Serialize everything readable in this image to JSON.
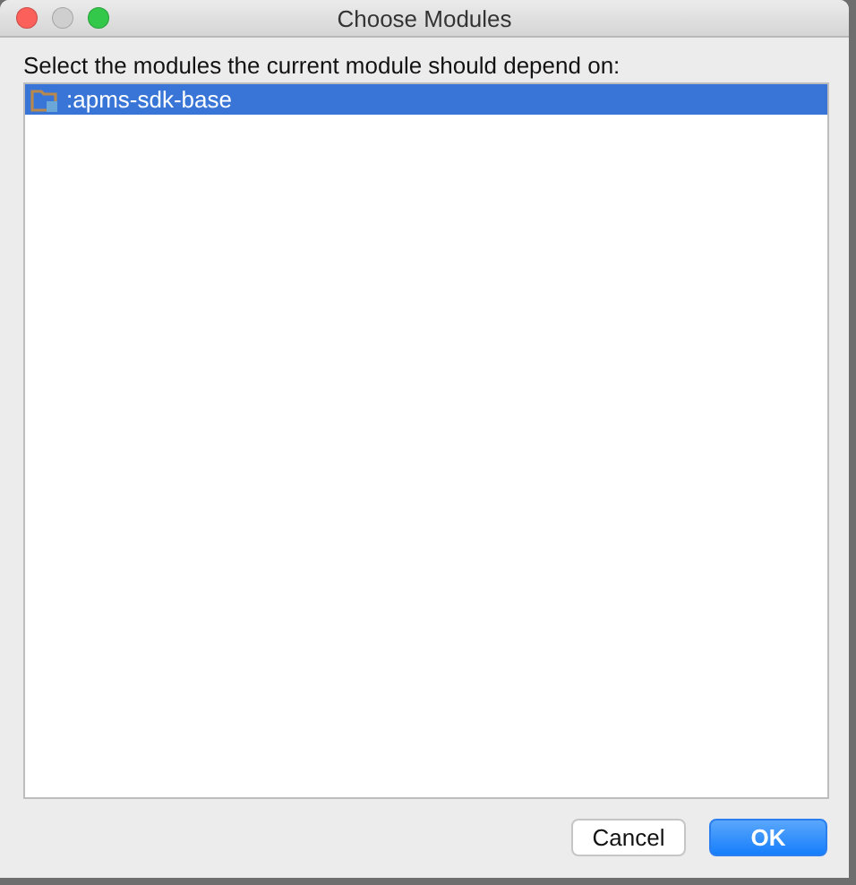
{
  "window": {
    "title": "Choose Modules",
    "controls": [
      {
        "kind": "close",
        "disabled": false
      },
      {
        "kind": "minimize",
        "disabled": true
      },
      {
        "kind": "zoom",
        "disabled": false
      }
    ]
  },
  "prompt": "Select the modules the current module should depend on:",
  "modules": [
    {
      "label": ":apms-sdk-base",
      "selected": true
    }
  ],
  "buttons": [
    {
      "label": "Cancel",
      "kind": "secondary"
    },
    {
      "label": "OK",
      "kind": "primary"
    }
  ]
}
